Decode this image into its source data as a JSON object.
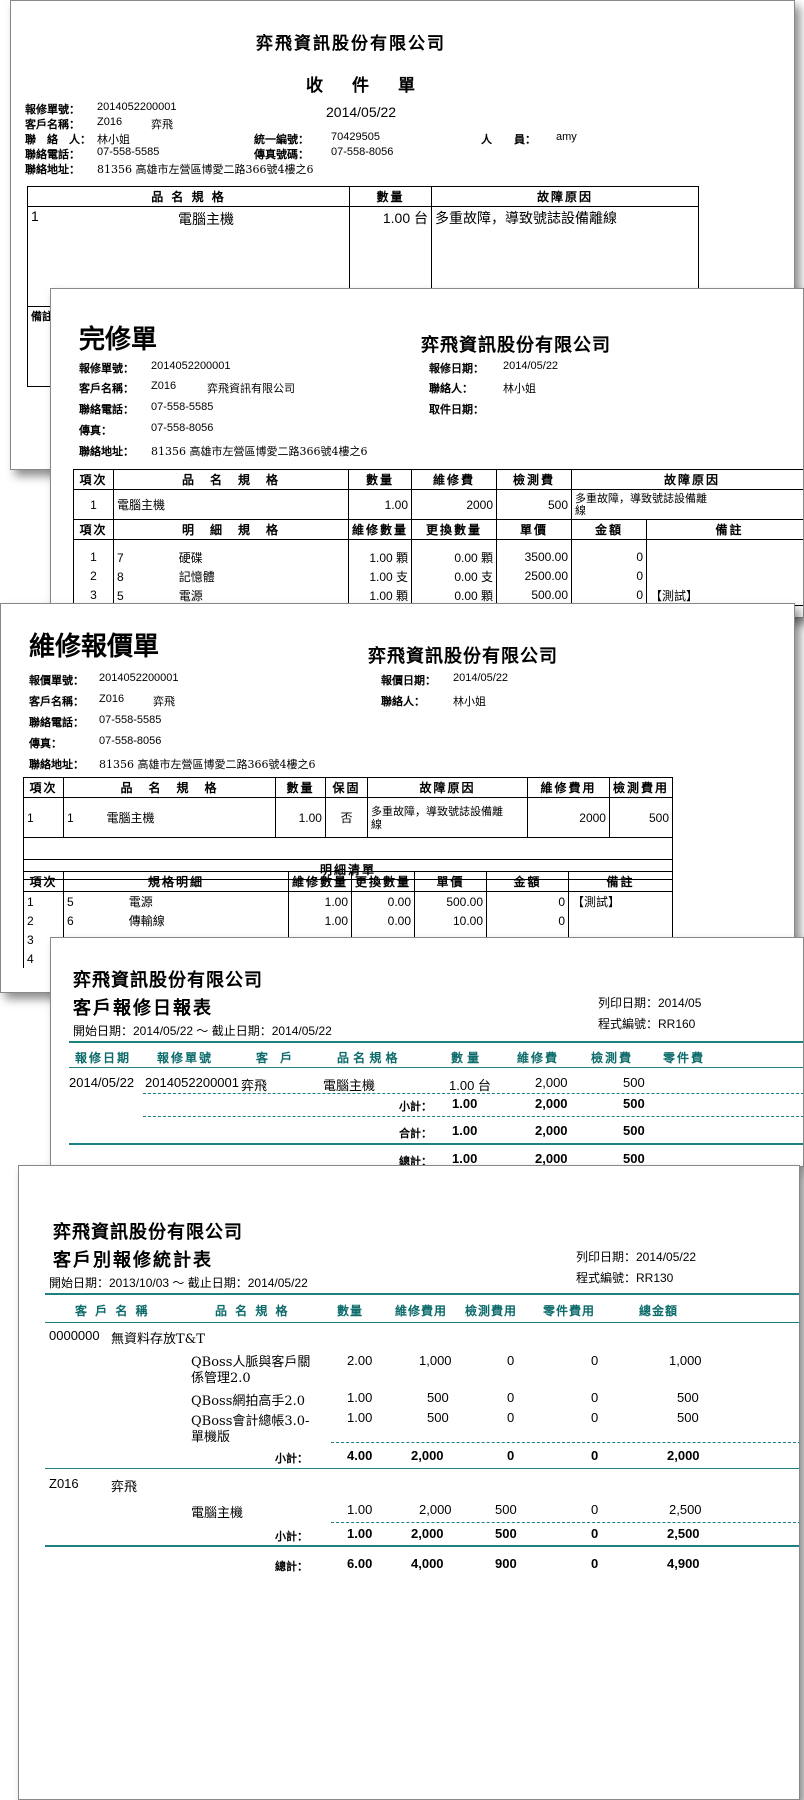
{
  "s1": {
    "company": "弈飛資訊股份有限公司",
    "title": "收　件　單",
    "date": "2014/05/22",
    "labels": {
      "no": "報修單號：",
      "cust": "客戶名稱：",
      "contact": "聯　絡　人：",
      "phone": "聯絡電話：",
      "addr": "聯絡地址：",
      "taxid": "統一編號：",
      "fax": "傳真號碼：",
      "staff": "人　　員："
    },
    "no": "2014052200001",
    "cust_code": "Z016",
    "cust_name": "弈飛",
    "contact": "林小姐",
    "phone": "07-558-5585",
    "addr": "81356 高雄市左營區博愛二路366號4樓之6",
    "taxid": "70429505",
    "fax": "07-558-8056",
    "staff": "amy",
    "headers": [
      "品 名 規 格",
      "數量",
      "故障原因"
    ],
    "row": {
      "no": "1",
      "item": "電腦主機",
      "qty": "1.00 台",
      "reason": "多重故障，導致號誌設備離線"
    },
    "note_label": "備註"
  },
  "s2": {
    "title": "完修單",
    "company": "弈飛資訊股份有限公司",
    "labels": {
      "no": "報修單號：",
      "cust": "客戶名稱：",
      "phone": "聯絡電話：",
      "fax": "傳真：",
      "addr": "聯絡地址：",
      "rdate": "報修日期：",
      "contact": "聯絡人：",
      "pickup": "取件日期："
    },
    "no": "2014052200001",
    "cust_code": "Z016",
    "cust_name": "弈飛資訊有限公司",
    "phone": "07-558-5585",
    "fax": "07-558-8056",
    "addr": "81356 高雄市左營區博愛二路366號4樓之6",
    "rdate": "2014/05/22",
    "contact": "林小姐",
    "headers1": [
      "項次",
      "品　名　規　格",
      "數量",
      "維修費",
      "檢測費",
      "故障原因"
    ],
    "row1": {
      "no": "1",
      "item": "電腦主機",
      "qty": "1.00",
      "fee": "2000",
      "test": "500",
      "reason1": "多重故障，導致號誌設備離",
      "reason2": "線"
    },
    "headers2": [
      "項次",
      "明　細　規　格",
      "維修數量",
      "更換數量",
      "單價",
      "金額",
      "備註"
    ],
    "rows2": [
      {
        "n": "1",
        "c": "7",
        "item": "硬碟",
        "q": "1.00 顆",
        "rq": "0.00 顆",
        "price": "3500.00",
        "amt": "0",
        "note": ""
      },
      {
        "n": "2",
        "c": "8",
        "item": "記憶體",
        "q": "1.00 支",
        "rq": "0.00 支",
        "price": "2500.00",
        "amt": "0",
        "note": ""
      },
      {
        "n": "3",
        "c": "5",
        "item": "電源",
        "q": "1.00 顆",
        "rq": "0.00 顆",
        "price": "500.00",
        "amt": "0",
        "note": "【測試】"
      }
    ]
  },
  "s3": {
    "title": "維修報價單",
    "company": "弈飛資訊股份有限公司",
    "labels": {
      "no": "報價單號：",
      "cust": "客戶名稱：",
      "phone": "聯絡電話：",
      "fax": "傳真：",
      "addr": "聯絡地址：",
      "qdate": "報價日期：",
      "contact": "聯絡人："
    },
    "no": "2014052200001",
    "cust_code": "Z016",
    "cust_name": "弈飛",
    "phone": "07-558-5585",
    "fax": "07-558-8056",
    "addr": "81356 高雄市左營區博愛二路366號4樓之6",
    "qdate": "2014/05/22",
    "contact": "林小姐",
    "headers1": [
      "項次",
      "品　名　規　格",
      "數量",
      "保固",
      "故障原因",
      "維修費用",
      "檢測費用"
    ],
    "row1": {
      "n": "1",
      "c": "1",
      "item": "電腦主機",
      "qty": "1.00",
      "warranty": "否",
      "reason1": "多重故障，導致號誌設備離",
      "reason2": "線",
      "fee": "2000",
      "test": "500"
    },
    "detail_title": "明細清單",
    "headers2": [
      "項次",
      "規格明細",
      "維修數量",
      "更換數量",
      "單價",
      "金額",
      "備註"
    ],
    "rows2": [
      {
        "n": "1",
        "c": "5",
        "item": "電源",
        "q": "1.00",
        "rq": "0.00",
        "price": "500.00",
        "amt": "0",
        "note": "【測試】"
      },
      {
        "n": "2",
        "c": "6",
        "item": "傳輸線",
        "q": "1.00",
        "rq": "0.00",
        "price": "10.00",
        "amt": "0",
        "note": ""
      },
      {
        "n": "3",
        "c": "",
        "item": "",
        "q": "",
        "rq": "",
        "price": "",
        "amt": "",
        "note": ""
      },
      {
        "n": "4",
        "c": "",
        "item": "",
        "q": "",
        "rq": "",
        "price": "",
        "amt": "",
        "note": ""
      }
    ]
  },
  "s4": {
    "company": "弈飛資訊股份有限公司",
    "title": "客戶報修日報表",
    "period": "開始日期：2014/05/22 ～ 截止日期：2014/05/22",
    "print_date": "列印日期：2014/05",
    "prog": "程式編號：RR160",
    "headers": [
      "報修日期",
      "報修單號",
      "客　戶",
      "品 名 規 格",
      "數 量",
      "維修費",
      "檢測費",
      "零件費"
    ],
    "row": {
      "date": "2014/05/22",
      "no": "2014052200001",
      "cust": "弈飛",
      "item": "電腦主機",
      "qty": "1.00 台",
      "fee": "2,000",
      "test": "500"
    },
    "subtotal": {
      "label": "小計：",
      "qty": "1.00",
      "fee": "2,000",
      "test": "500"
    },
    "sum": {
      "label": "合計：",
      "qty": "1.00",
      "fee": "2,000",
      "test": "500"
    },
    "total": {
      "label": "總計：",
      "qty": "1.00",
      "fee": "2,000",
      "test": "500"
    }
  },
  "s5": {
    "company": "弈飛資訊股份有限公司",
    "title": "客戶別報修統計表",
    "period": "開始日期：2013/10/03 ～ 截止日期：2014/05/22",
    "print_date": "列印日期：2014/05/22",
    "prog": "程式編號：RR130",
    "headers": [
      "客 戶 名 稱",
      "品 名 規 格",
      "數量",
      "維修費用",
      "檢測費用",
      "零件費用",
      "總金額"
    ],
    "g1": {
      "code": "0000000",
      "name": "無資料存放T&T",
      "rows": [
        {
          "i1": "QBoss人脈與客戶關",
          "i2": "係管理2.0",
          "qty": "2.00",
          "fee": "1,000",
          "test": "0",
          "part": "0",
          "total": "1,000"
        },
        {
          "i1": "QBoss網拍高手2.0",
          "i2": "",
          "qty": "1.00",
          "fee": "500",
          "test": "0",
          "part": "0",
          "total": "500"
        },
        {
          "i1": "QBoss會計總帳3.0-",
          "i2": "單機版",
          "qty": "1.00",
          "fee": "500",
          "test": "0",
          "part": "0",
          "total": "500"
        }
      ],
      "sub": {
        "label": "小計：",
        "qty": "4.00",
        "fee": "2,000",
        "test": "0",
        "part": "0",
        "total": "2,000"
      }
    },
    "g2": {
      "code": "Z016",
      "name": "弈飛",
      "rows": [
        {
          "i1": "電腦主機",
          "qty": "1.00",
          "fee": "2,000",
          "test": "500",
          "part": "0",
          "total": "2,500"
        }
      ],
      "sub": {
        "label": "小計：",
        "qty": "1.00",
        "fee": "2,000",
        "test": "500",
        "part": "0",
        "total": "2,500"
      }
    },
    "total": {
      "label": "總計：",
      "qty": "6.00",
      "fee": "4,000",
      "test": "900",
      "part": "0",
      "total": "4,900"
    }
  }
}
